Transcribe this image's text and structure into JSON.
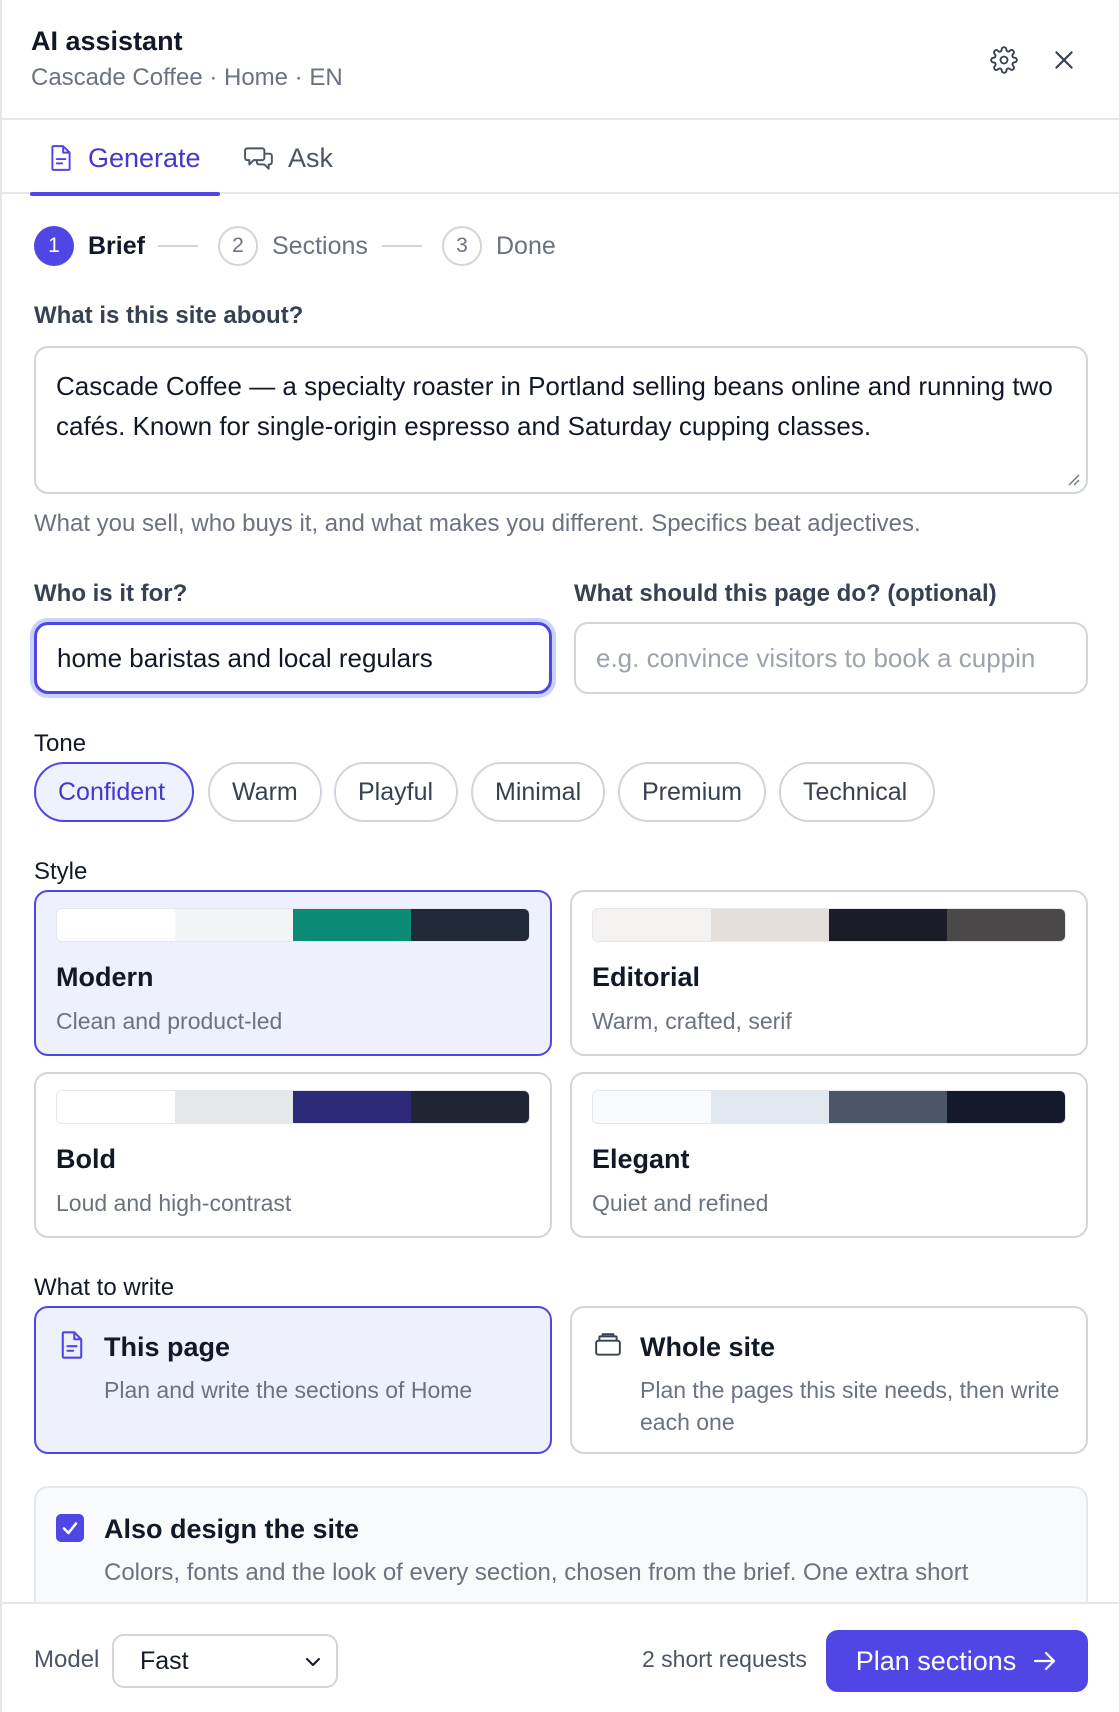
{
  "header": {
    "title": "AI assistant",
    "subtitle": "Cascade Coffee · Home · EN",
    "icons": [
      "gear-icon",
      "close-icon"
    ]
  },
  "tabs": [
    {
      "label": "Generate",
      "icon": "document-icon",
      "active": true
    },
    {
      "label": "Ask",
      "icon": "chat-icon",
      "active": false
    }
  ],
  "stepper": [
    {
      "number": "1",
      "label": "Brief",
      "state": "current"
    },
    {
      "number": "2",
      "label": "Sections",
      "state": "pending"
    },
    {
      "number": "3",
      "label": "Done",
      "state": "pending"
    }
  ],
  "brief": {
    "label": "What is this site about?",
    "value": "Cascade Coffee — a specialty roaster in Portland selling beans online and running two cafés. Known for single-origin espresso and Saturday cupping classes.",
    "helper": "What you sell, who buys it, and what makes you different. Specifics beat adjectives."
  },
  "audience": {
    "label": "Who is it for?",
    "value": "home baristas and local regulars"
  },
  "goal": {
    "label": "What should this page do? (optional)",
    "placeholder": "e.g. convince visitors to book a cuppin"
  },
  "tone": {
    "label": "Tone",
    "options": [
      "Confident",
      "Warm",
      "Playful",
      "Minimal",
      "Premium",
      "Technical"
    ],
    "selected": "Confident"
  },
  "style": {
    "label": "Style",
    "selected": "Modern",
    "options": [
      {
        "name": "Modern",
        "desc": "Clean and product-led",
        "colors": [
          "#ffffff",
          "#f3f4f6",
          "#0b8a76",
          "#1f2937"
        ]
      },
      {
        "name": "Editorial",
        "desc": "Warm, crafted, serif",
        "colors": [
          "#f5f3f1",
          "#e4dfdb",
          "#1c1c26",
          "#4a4848"
        ]
      },
      {
        "name": "Bold",
        "desc": "Loud and high-contrast",
        "colors": [
          "#ffffff",
          "#e5e7eb",
          "#2e2a7a",
          "#1f2533"
        ]
      },
      {
        "name": "Elegant",
        "desc": "Quiet and refined",
        "colors": [
          "#f8fafc",
          "#e2e8f0",
          "#4a5568",
          "#141a2c"
        ]
      }
    ]
  },
  "write": {
    "label": "What to write",
    "options": [
      {
        "title": "This page",
        "desc": "Plan and write the sections of Home",
        "icon": "document-icon",
        "selected": true
      },
      {
        "title": "Whole site",
        "desc": "Plan the pages this site needs, then write each one",
        "icon": "stack-icon",
        "selected": false
      }
    ]
  },
  "design": {
    "checked": true,
    "title": "Also design the site",
    "desc": "Colors, fonts and the look of every section, chosen from the brief. One extra short request."
  },
  "footer": {
    "model_label": "Model",
    "model_value": "Fast",
    "requests": "2 short requests",
    "primary_label": "Plan sections"
  },
  "colors": {
    "accent": "#4f46e5",
    "accent_text": "#4338ca",
    "selected_bg": "#eef0fc"
  }
}
